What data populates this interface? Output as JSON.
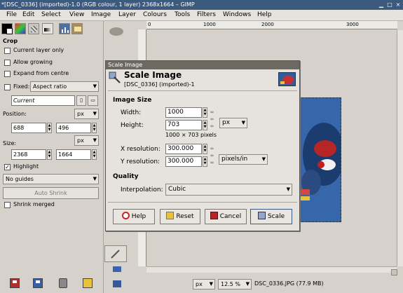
{
  "window": {
    "title": "*[DSC_0336] (imported)-1.0 (RGB colour, 1 layer) 2368x1664 – GIMP"
  },
  "menubar": {
    "items": [
      "File",
      "Edit",
      "Select",
      "View",
      "Image",
      "Layer",
      "Colours",
      "Tools",
      "Filters",
      "Windows",
      "Help"
    ]
  },
  "toolbox": {
    "section_title": "Crop",
    "current_layer_only": "Current layer only",
    "allow_growing": "Allow growing",
    "expand_from_centre": "Expand from centre",
    "fixed_label": "Fixed:",
    "fixed_option": "Aspect ratio",
    "aspect_value": "Current",
    "position_label": "Position:",
    "position_unit": "px",
    "position_x": "688",
    "position_y": "496",
    "size_label": "Size:",
    "size_unit": "px",
    "size_w": "2368",
    "size_h": "1664",
    "highlight": "Highlight",
    "guides_option": "No guides",
    "auto_shrink": "Auto Shrink",
    "shrink_merged": "Shrink merged"
  },
  "ruler": {
    "labels": [
      "0",
      "1000",
      "2000",
      "3000"
    ]
  },
  "dialog": {
    "window_title": "Scale Image",
    "header_title": "Scale Image",
    "header_subtitle": "[DSC_0336] (imported)-1",
    "image_size_heading": "Image Size",
    "width_label": "Width:",
    "width_value": "1000",
    "height_label": "Height:",
    "height_value": "703",
    "size_unit": "px",
    "pixels_info": "1000 × 703 pixels",
    "xres_label": "X resolution:",
    "xres_value": "300.000",
    "yres_label": "Y resolution:",
    "yres_value": "300.000",
    "res_unit": "pixels/in",
    "quality_heading": "Quality",
    "interpolation_label": "Interpolation:",
    "interpolation_value": "Cubic",
    "buttons": {
      "help": "Help",
      "reset": "Reset",
      "cancel": "Cancel",
      "scale": "Scale"
    }
  },
  "statusbar": {
    "unit": "px",
    "zoom": "12.5 %",
    "file_info": "DSC_0336.JPG (77.9 MB)"
  },
  "colors": {
    "titlebar": "#3c5a7e",
    "dialog_titlebar": "#6b6962",
    "background": "#d6d2cb"
  }
}
